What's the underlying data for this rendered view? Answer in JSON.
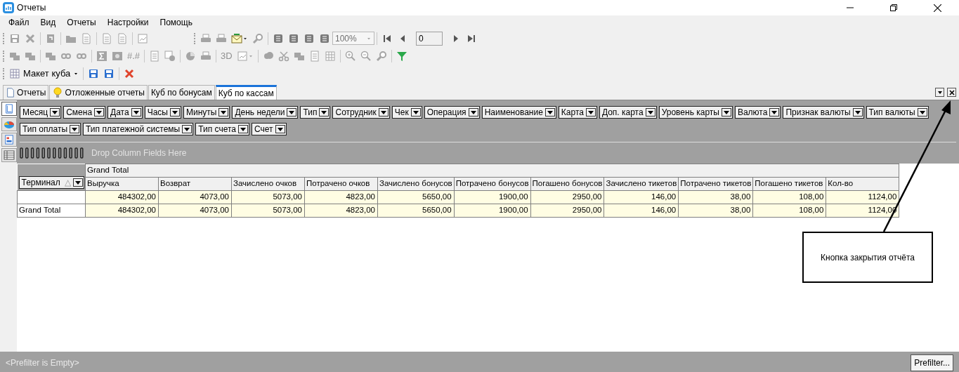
{
  "window": {
    "title": "Отчеты"
  },
  "menu": [
    "Файл",
    "Вид",
    "Отчеты",
    "Настройки",
    "Помощь"
  ],
  "toolbars": [
    [
      {
        "kind": "grip"
      },
      {
        "kind": "button",
        "disabled": true
      },
      {
        "kind": "button",
        "disabled": true
      },
      {
        "kind": "sep"
      },
      {
        "kind": "button",
        "disabled": true
      },
      {
        "kind": "sep"
      },
      {
        "kind": "button",
        "disabled": true
      },
      {
        "kind": "button",
        "disabled": true
      },
      {
        "kind": "sep"
      },
      {
        "kind": "button",
        "disabled": true
      },
      {
        "kind": "button",
        "disabled": true
      },
      {
        "kind": "sep"
      },
      {
        "kind": "button",
        "disabled": true
      },
      {
        "kind": "space"
      },
      {
        "kind": "grip"
      },
      {
        "kind": "button",
        "disabled": true
      },
      {
        "kind": "button",
        "disabled": true
      },
      {
        "kind": "dropdown",
        "disabled": false
      },
      {
        "kind": "button",
        "disabled": true
      },
      {
        "kind": "sep"
      },
      {
        "kind": "button",
        "disabled": false
      },
      {
        "kind": "button",
        "disabled": false
      },
      {
        "kind": "button",
        "disabled": false
      },
      {
        "kind": "button",
        "disabled": false
      },
      {
        "kind": "combo",
        "value": "100%",
        "disabled": true
      },
      {
        "kind": "sep"
      },
      {
        "kind": "button",
        "disabled": false
      },
      {
        "kind": "button",
        "disabled": false
      },
      {
        "kind": "field",
        "value": "0"
      },
      {
        "kind": "button",
        "disabled": false
      },
      {
        "kind": "button",
        "disabled": false
      }
    ],
    [
      {
        "kind": "grip"
      },
      {
        "kind": "button",
        "disabled": true
      },
      {
        "kind": "button",
        "disabled": true
      },
      {
        "kind": "sep"
      },
      {
        "kind": "button",
        "disabled": true
      },
      {
        "kind": "button",
        "disabled": true
      },
      {
        "kind": "button",
        "disabled": true
      },
      {
        "kind": "sep"
      },
      {
        "kind": "button",
        "disabled": true
      },
      {
        "kind": "button",
        "disabled": true
      },
      {
        "kind": "text",
        "label": "#.#",
        "disabled": true
      },
      {
        "kind": "sep"
      },
      {
        "kind": "button",
        "disabled": true
      },
      {
        "kind": "button",
        "disabled": true
      },
      {
        "kind": "sep"
      },
      {
        "kind": "button",
        "disabled": true
      },
      {
        "kind": "button",
        "disabled": true
      },
      {
        "kind": "sep"
      },
      {
        "kind": "text",
        "label": "3D",
        "disabled": true
      },
      {
        "kind": "dropdown",
        "disabled": true
      },
      {
        "kind": "sep"
      },
      {
        "kind": "button",
        "disabled": true
      },
      {
        "kind": "button",
        "disabled": true
      },
      {
        "kind": "button",
        "disabled": true
      },
      {
        "kind": "button",
        "disabled": true
      },
      {
        "kind": "button",
        "disabled": true
      },
      {
        "kind": "sep"
      },
      {
        "kind": "button",
        "disabled": true
      },
      {
        "kind": "button",
        "disabled": true
      },
      {
        "kind": "button",
        "disabled": true
      },
      {
        "kind": "sep"
      },
      {
        "kind": "button",
        "disabled": false
      }
    ],
    [
      {
        "kind": "grip"
      },
      {
        "kind": "menu",
        "label": "Макет куба"
      },
      {
        "kind": "sep"
      },
      {
        "kind": "button",
        "disabled": false
      },
      {
        "kind": "button",
        "disabled": false
      },
      {
        "kind": "sep"
      },
      {
        "kind": "button",
        "disabled": false
      }
    ]
  ],
  "tabs": [
    {
      "label": "Отчеты",
      "selected": false
    },
    {
      "label": "Отложенные отчеты",
      "selected": false
    },
    {
      "label": "Куб по бонусам",
      "selected": false
    },
    {
      "label": "Куб по кассам",
      "selected": true
    }
  ],
  "side_tabs": [
    {
      "selected": true
    },
    {
      "selected": false
    },
    {
      "selected": false
    },
    {
      "selected": false
    }
  ],
  "filter_fields": [
    "Месяц",
    "Смена",
    "Дата",
    "Часы",
    "Минуты",
    "День недели",
    "Тип",
    "Сотрудник",
    "Чек",
    "Операция",
    "Наименование",
    "Карта",
    "Доп. карта",
    "Уровень карты",
    "Валюта",
    "Признак валюты",
    "Тип валюты",
    "Тип оплаты",
    "Тип платежной системы",
    "Тип счета",
    "Счет"
  ],
  "column_area": {
    "hint": "Drop Column Fields Here"
  },
  "pivot": {
    "row_field": {
      "label": "Терминал",
      "sort_glyph": "△"
    },
    "column_header": "Grand Total",
    "columns": [
      "Выручка",
      "Возврат",
      "Зачислено очков",
      "Потрачено очков",
      "Зачислено бонусов",
      "Потрачено бонусов",
      "Погашено бонусов",
      "Зачислено тикетов",
      "Потрачено тикетов",
      "Погашено тикетов",
      "Кол-во"
    ],
    "rows": [
      {
        "values": [
          "484302,00",
          "4073,00",
          "5073,00",
          "4823,00",
          "5650,00",
          "1900,00",
          "2950,00",
          "146,00",
          "38,00",
          "108,00",
          "1124,00"
        ]
      },
      {
        "label": "Grand Total",
        "values": [
          "484302,00",
          "4073,00",
          "5073,00",
          "4823,00",
          "5650,00",
          "1900,00",
          "2950,00",
          "146,00",
          "38,00",
          "108,00",
          "1124,00"
        ]
      }
    ]
  },
  "status_bar": {
    "text": "<Prefilter is Empty>",
    "button": "Prefilter..."
  },
  "callout": {
    "text": "Кнопка закрытия отчёта"
  }
}
